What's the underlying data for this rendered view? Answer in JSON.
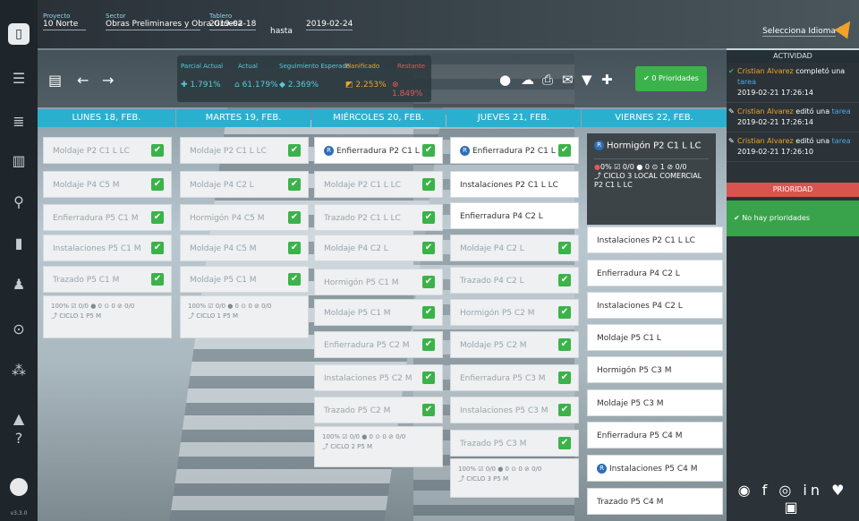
{
  "header": {
    "proyecto_label": "Proyecto",
    "proyecto_value": "10 Norte",
    "sector_label": "Sector",
    "sector_value": "Obras Preliminares y Obra Gruesa",
    "tablero_label": "Tablero",
    "date_from": "2019-02-18",
    "hasta": "hasta",
    "date_to": "2019-02-24",
    "language": "Selecciona Idioma"
  },
  "kpi": {
    "parcial_actual_label": "Parcial Actual",
    "actual_label": "Actual",
    "seguimiento_label": "Seguimiento Esperado",
    "planificado_label": "Planificado",
    "restante_label": "Restante",
    "parcial_actual": "1.791%",
    "actual": "61.179%",
    "seguimiento": "2.369%",
    "planificado": "2.253%",
    "restante": "1.849%"
  },
  "prio_button": "0 Prioridades",
  "days": [
    "LUNES 18, FEB.",
    "MARTES 19, FEB.",
    "MIÉRCOLES 20, FEB.",
    "JUEVES 21, FEB.",
    "VIERNES 22, FEB."
  ],
  "monday": [
    "Moldaje P2 C1 L LC",
    "Moldaje P4 C5 M",
    "Enfierradura P5 C1 M",
    "Instalaciones P5 C1 M",
    "Trazado P5 C1 M"
  ],
  "monday_foot": {
    "stats": "100% ☑ 0/0 ● 0 ⊙ 0 ⊘ 0/0",
    "cycle": "CICLO 1 P5 M"
  },
  "tuesday": [
    "Moldaje P2 C1 L LC",
    "Moldaje P4 C2 L",
    "Hormigón P4 C5 M",
    "Moldaje P4 C5 M",
    "Moldaje P5 C1 M"
  ],
  "tuesday_foot": {
    "stats": "100% ☑ 0/0 ● 0 ⊙ 0 ⊘ 0/0",
    "cycle": "CICLO 1 P5 M"
  },
  "wednesday": [
    "Enfierradura P2 C1 L LC",
    "Moldaje P2 C1 L LC",
    "Trazado P2 C1 L LC",
    "Moldaje P4 C2 L",
    "Hormigón P5 C1 M",
    "Moldaje P5 C1 M",
    "Enfierradura P5 C2 M",
    "Instalaciones P5 C2 M",
    "Trazado P5 C2 M"
  ],
  "wednesday_foot": {
    "stats": "100% ☑ 0/0 ● 0 ⊙ 0 ⊘ 0/0",
    "cycle": "CICLO 2 P5 M"
  },
  "thursday": [
    "Enfierradura P2 C1 L LC",
    "Instalaciones P2 C1 L LC",
    "Enfierradura P4 C2 L",
    "Moldaje P4 C2 L",
    "Trazado P4 C2 L",
    "Hormigón P5 C2 M",
    "Moldaje P5 C2 M",
    "Enfierradura P5 C3 M",
    "Instalaciones P5 C3 M",
    "Trazado P5 C3 M"
  ],
  "thursday_foot": {
    "stats": "100% ☑ 0/0 ● 0 ⊙ 0 ⊘ 0/0",
    "cycle": "CICLO 3 P5 M"
  },
  "friday_highlight": {
    "title": "Hormigón P2 C1 L LC",
    "stats": "0% ☑ 0/0 ● 0 ⊙ 1 ⊘ 0/0",
    "cycle": "CICLO 3 LOCAL COMERCIAL P2 C1 L LC"
  },
  "friday": [
    "Instalaciones P2 C1 L LC",
    "Enfierradura P4 C2 L",
    "Instalaciones P4 C2 L",
    "Moldaje P5 C1 L",
    "Hormigón P5 C3 M",
    "Moldaje P5 C3 M",
    "Enfierradura P5 C4 M",
    "Instalaciones P5 C4 M",
    "Trazado P5 C4 M"
  ],
  "activity": {
    "title": "ACTIVIDAD",
    "items": [
      {
        "name": "Cristian Alvarez",
        "action": "completó una",
        "obj": "tarea",
        "time": "2019-02-21 17:26:14"
      },
      {
        "name": "Cristian Alvarez",
        "action": "editó una",
        "obj": "tarea",
        "time": "2019-02-21 17:26:14"
      },
      {
        "name": "Cristian Alvarez",
        "action": "editó una",
        "obj": "tarea",
        "time": "2019-02-21 17:26:10"
      }
    ]
  },
  "priority": {
    "title": "PRIORIDAD",
    "empty": "No hay prioridades"
  },
  "version": "v3.3.0"
}
